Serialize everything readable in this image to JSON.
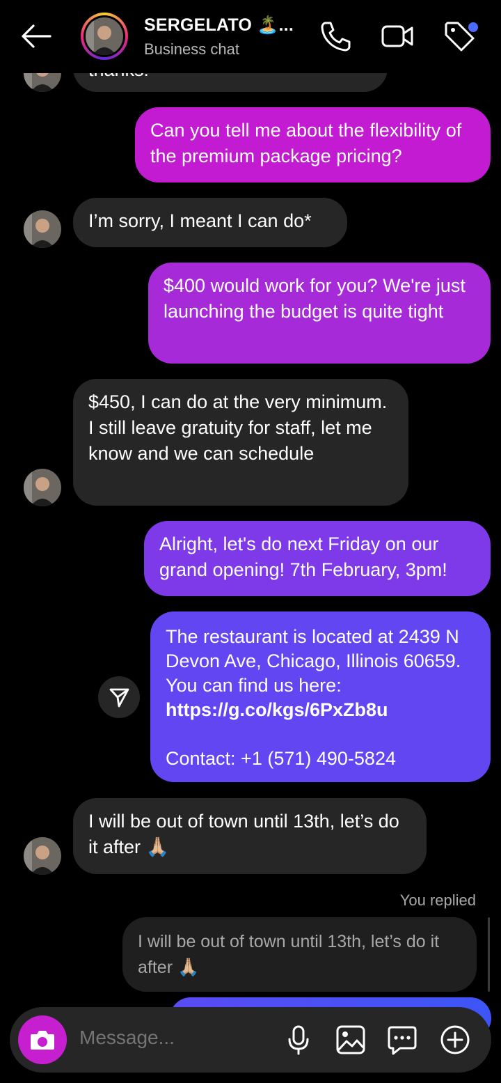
{
  "header": {
    "title": "SERGELATO 🏝️...",
    "subtitle": "Business chat"
  },
  "messages": [
    {
      "from": "them",
      "text": "thanks!"
    },
    {
      "from": "me",
      "text": "Can you tell me about the flexibility of the premium package pricing?"
    },
    {
      "from": "them",
      "text": "I’m sorry, I meant I can do*"
    },
    {
      "from": "me",
      "text": "$400 would work for you? We're just launching the budget is quite tight"
    },
    {
      "from": "them",
      "text": "$450, I can do at the very minimum. I still leave gratuity for staff, let me know and we can schedule"
    },
    {
      "from": "me",
      "text": "Alright, let's do next Friday on our grand opening! 7th February, 3pm!"
    },
    {
      "from": "me",
      "text_before": "The restaurant is located at 2439 N Devon Ave, Chicago, Illinois 60659. You can find us here:",
      "link": "https://g.co/kgs/6PxZb8u",
      "contact": "Contact: +1 (571) 490-5824"
    },
    {
      "from": "them",
      "text": "I will be out of town until 13th, let’s do it after 🙏🏼"
    }
  ],
  "reply": {
    "label": "You replied",
    "quoted": "I will be out of town until 13th, let’s do it after 🙏🏼"
  },
  "composer": {
    "placeholder": "Message..."
  },
  "colors": {
    "bubble_in": "#262626",
    "gradient_top": "#c51fd0",
    "gradient_bottom": "#5c48f6",
    "accent_dot": "#4a6cff"
  },
  "icons": [
    "back-arrow-icon",
    "phone-icon",
    "video-camera-icon",
    "tag-icon",
    "share-icon",
    "camera-icon",
    "microphone-icon",
    "gallery-icon",
    "sticker-chat-icon",
    "plus-circle-icon"
  ]
}
